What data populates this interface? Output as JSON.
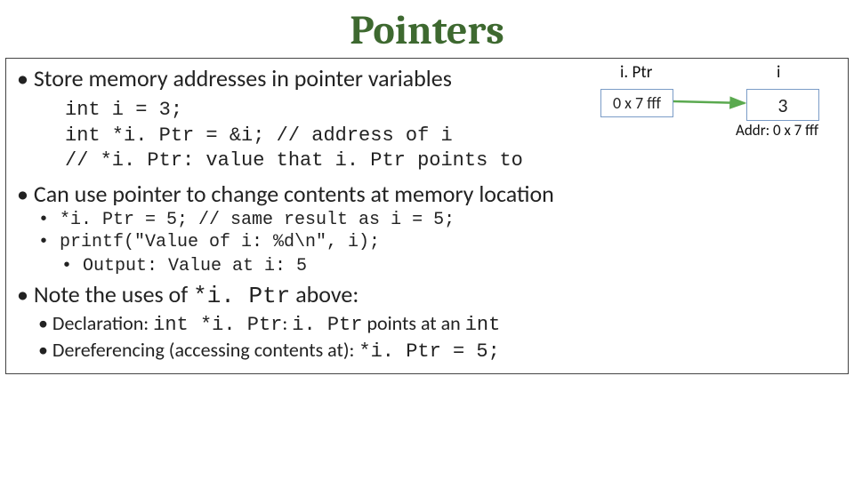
{
  "title": "Pointers",
  "content": {
    "b1_store": "• Store memory addresses in pointer variables",
    "code1": "int i = 3;\nint *i. Ptr = &i; // address of i\n// *i. Ptr: value that i. Ptr points to",
    "b1_canuse": "• Can use pointer to change contents at memory location",
    "b2_assign": "• *i. Ptr = 5;   // same result as i = 5;",
    "b2_printf": "• printf(\"Value of i: %d\\n\", i);",
    "b3_output": "• Output: Value at i: 5",
    "b1_note_prefix": "• Note the uses of ",
    "b1_note_code": "*i. Ptr",
    "b1_note_suffix": "  above:",
    "b2_decl_prefix": "• Declaration: ",
    "b2_decl_code1": "int *i. Ptr",
    "b2_decl_mid1": ": ",
    "b2_decl_code2": "i. Ptr",
    "b2_decl_mid2": " points at an ",
    "b2_decl_code3": "int",
    "b2_deref_prefix": "• Dereferencing (accessing contents at): ",
    "b2_deref_code": "*i. Ptr = 5;"
  },
  "diagram": {
    "iptr_label": "i. Ptr",
    "i_label": "i",
    "iptr_value": "0 x 7 fff",
    "i_value": "3",
    "addr_label": "Addr: 0 x 7 fff"
  }
}
